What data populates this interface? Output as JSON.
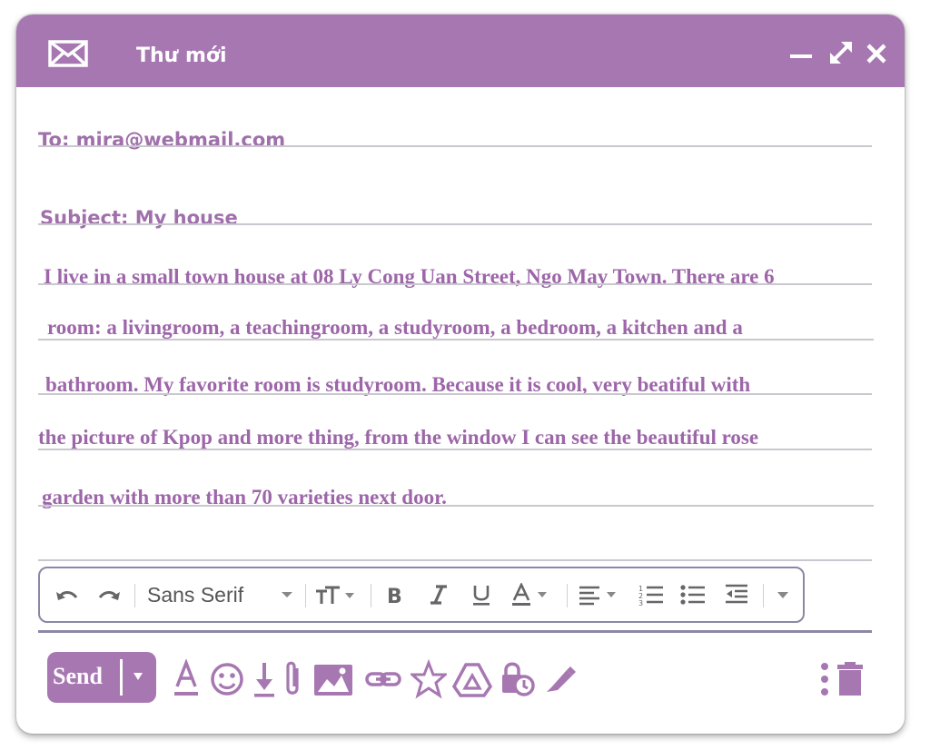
{
  "window": {
    "title": "Thư mới",
    "icons": {
      "mail": "envelope-icon",
      "minimize": "minimize-icon",
      "expand": "expand-icon",
      "close": "close-icon"
    }
  },
  "compose": {
    "to": "To: mira@webmail.com",
    "subject": "Subject: My house",
    "body_lines": [
      "I live in a small town house at 08 Ly Cong Uan Street, Ngo May Town. There are 6",
      "room: a livingroom, a teachingroom, a studyroom, a bedroom, a kitchen and a",
      "bathroom. My favorite room is studyroom. Because it is cool, very beatiful with",
      "the picture of Kpop and more thing, from the window I can see the beautiful rose",
      "garden with more than 70 varieties next door."
    ]
  },
  "toolbar": {
    "font": "Sans Serif",
    "icons": [
      "undo-icon",
      "redo-icon",
      "font-dropdown-icon",
      "text-size-icon",
      "bold-icon",
      "italic-icon",
      "underline-icon",
      "text-color-icon",
      "align-icon",
      "numbered-list-icon",
      "bulleted-list-icon",
      "indent-less-icon",
      "more-formatting-icon"
    ]
  },
  "actions": {
    "send_label": "Send",
    "icons": [
      "formatting-options-icon",
      "emoji-icon",
      "download-icon",
      "attach-icon",
      "insert-photo-icon",
      "insert-link-icon",
      "star-icon",
      "drive-icon",
      "confidential-mode-icon",
      "signature-icon",
      "more-options-icon",
      "delete-icon"
    ]
  },
  "colors": {
    "accent": "#a777b2",
    "text": "#9d66a9",
    "border": "#8a88a6"
  }
}
